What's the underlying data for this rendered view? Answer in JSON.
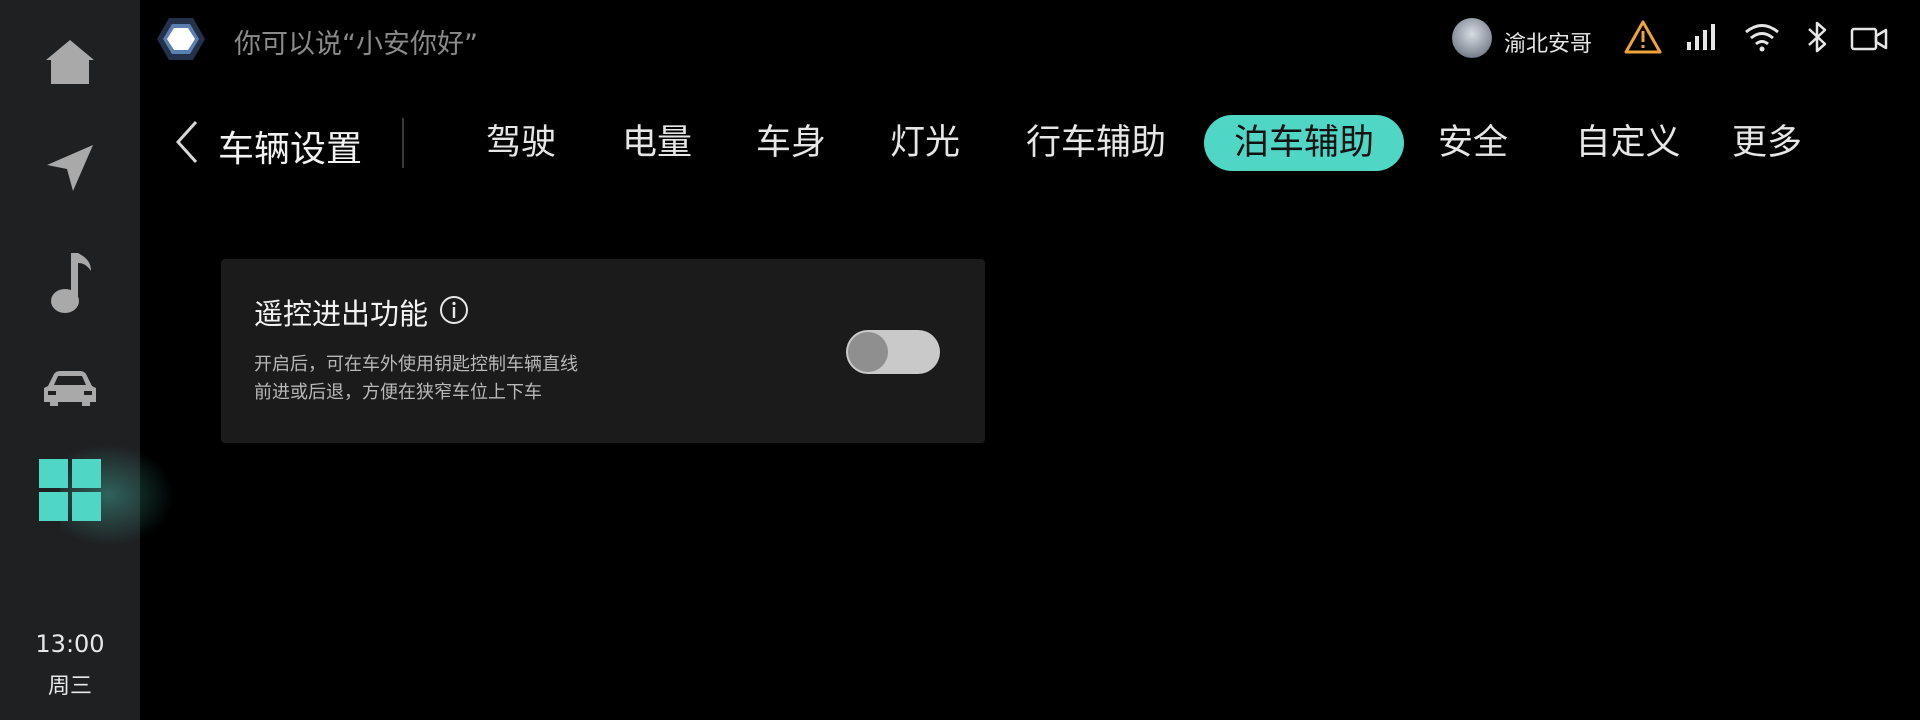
{
  "sidebar": {
    "items": [
      {
        "icon": "home-icon"
      },
      {
        "icon": "navigation-icon"
      },
      {
        "icon": "music-icon"
      },
      {
        "icon": "car-icon"
      },
      {
        "icon": "apps-grid-icon",
        "active": true
      }
    ],
    "time": "13:00",
    "day": "周三"
  },
  "status_bar": {
    "assistant_hint": "你可以说“小安你好”",
    "user_name": "渝北安哥",
    "icons": [
      "warning-icon",
      "signal-icon",
      "wifi-icon",
      "bluetooth-icon",
      "camera-icon"
    ]
  },
  "header": {
    "title": "车辆设置",
    "tabs": [
      {
        "label": "驾驶"
      },
      {
        "label": "电量"
      },
      {
        "label": "车身"
      },
      {
        "label": "灯光"
      },
      {
        "label": "行车辅助"
      },
      {
        "label": "泊车辅助",
        "active": true
      },
      {
        "label": "安全"
      },
      {
        "label": "自定义"
      },
      {
        "label": "更多"
      }
    ]
  },
  "card": {
    "title": "遥控进出功能",
    "desc_line1": "开启后，可在车外使用钥匙控制车辆直线",
    "desc_line2": "前进或后退，方便在狭窄车位上下车",
    "toggle_on": false
  },
  "colors": {
    "accent": "#4fd6c4",
    "background": "#000000",
    "sidebar": "#1f2022",
    "card": "#1b1b1b",
    "warning": "#f0a33a"
  }
}
